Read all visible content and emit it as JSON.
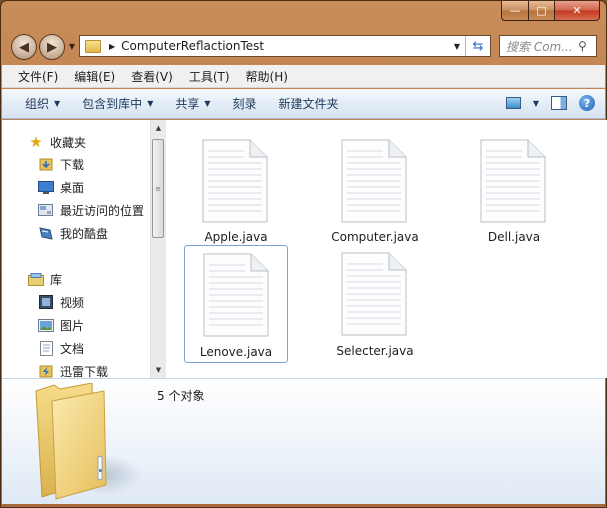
{
  "window": {
    "path": "ComputerReflactionTest"
  },
  "caption_buttons": {
    "minimize": "—",
    "maximize": "□",
    "close": "✕"
  },
  "search": {
    "placeholder": "搜索 Com..."
  },
  "menu": [
    "文件(F)",
    "编辑(E)",
    "查看(V)",
    "工具(T)",
    "帮助(H)"
  ],
  "commands": [
    {
      "label": "组织",
      "dropdown": true
    },
    {
      "label": "包含到库中",
      "dropdown": true
    },
    {
      "label": "共享",
      "dropdown": true
    },
    {
      "label": "刻录",
      "dropdown": false
    },
    {
      "label": "新建文件夹",
      "dropdown": false
    }
  ],
  "navpane": {
    "favorites": {
      "label": "收藏夹",
      "items": [
        "下载",
        "桌面",
        "最近访问的位置",
        "我的酷盘"
      ]
    },
    "libraries": {
      "label": "库",
      "items": [
        "视频",
        "图片",
        "文档",
        "迅雷下载"
      ]
    }
  },
  "files": [
    {
      "name": "Apple.java",
      "selected": false
    },
    {
      "name": "Computer.java",
      "selected": false
    },
    {
      "name": "Dell.java",
      "selected": false
    },
    {
      "name": "Lenove.java",
      "selected": true
    },
    {
      "name": "Selecter.java",
      "selected": false
    }
  ],
  "status": {
    "count": "5 个对象"
  },
  "icons": [
    "back-icon",
    "forward-icon",
    "folder-icon",
    "refresh-icon",
    "search-icon",
    "view-icon",
    "preview-pane-icon",
    "help-icon",
    "star-icon",
    "download-folder-icon",
    "desktop-icon",
    "recent-places-icon",
    "kupan-icon",
    "library-icon",
    "video-icon",
    "pictures-icon",
    "documents-icon",
    "thunder-download-icon",
    "java-file-icon"
  ],
  "colors": {
    "frame": "#b87a48",
    "command_bar": "#dfe9f5",
    "selection_border": "#7da2ce"
  }
}
